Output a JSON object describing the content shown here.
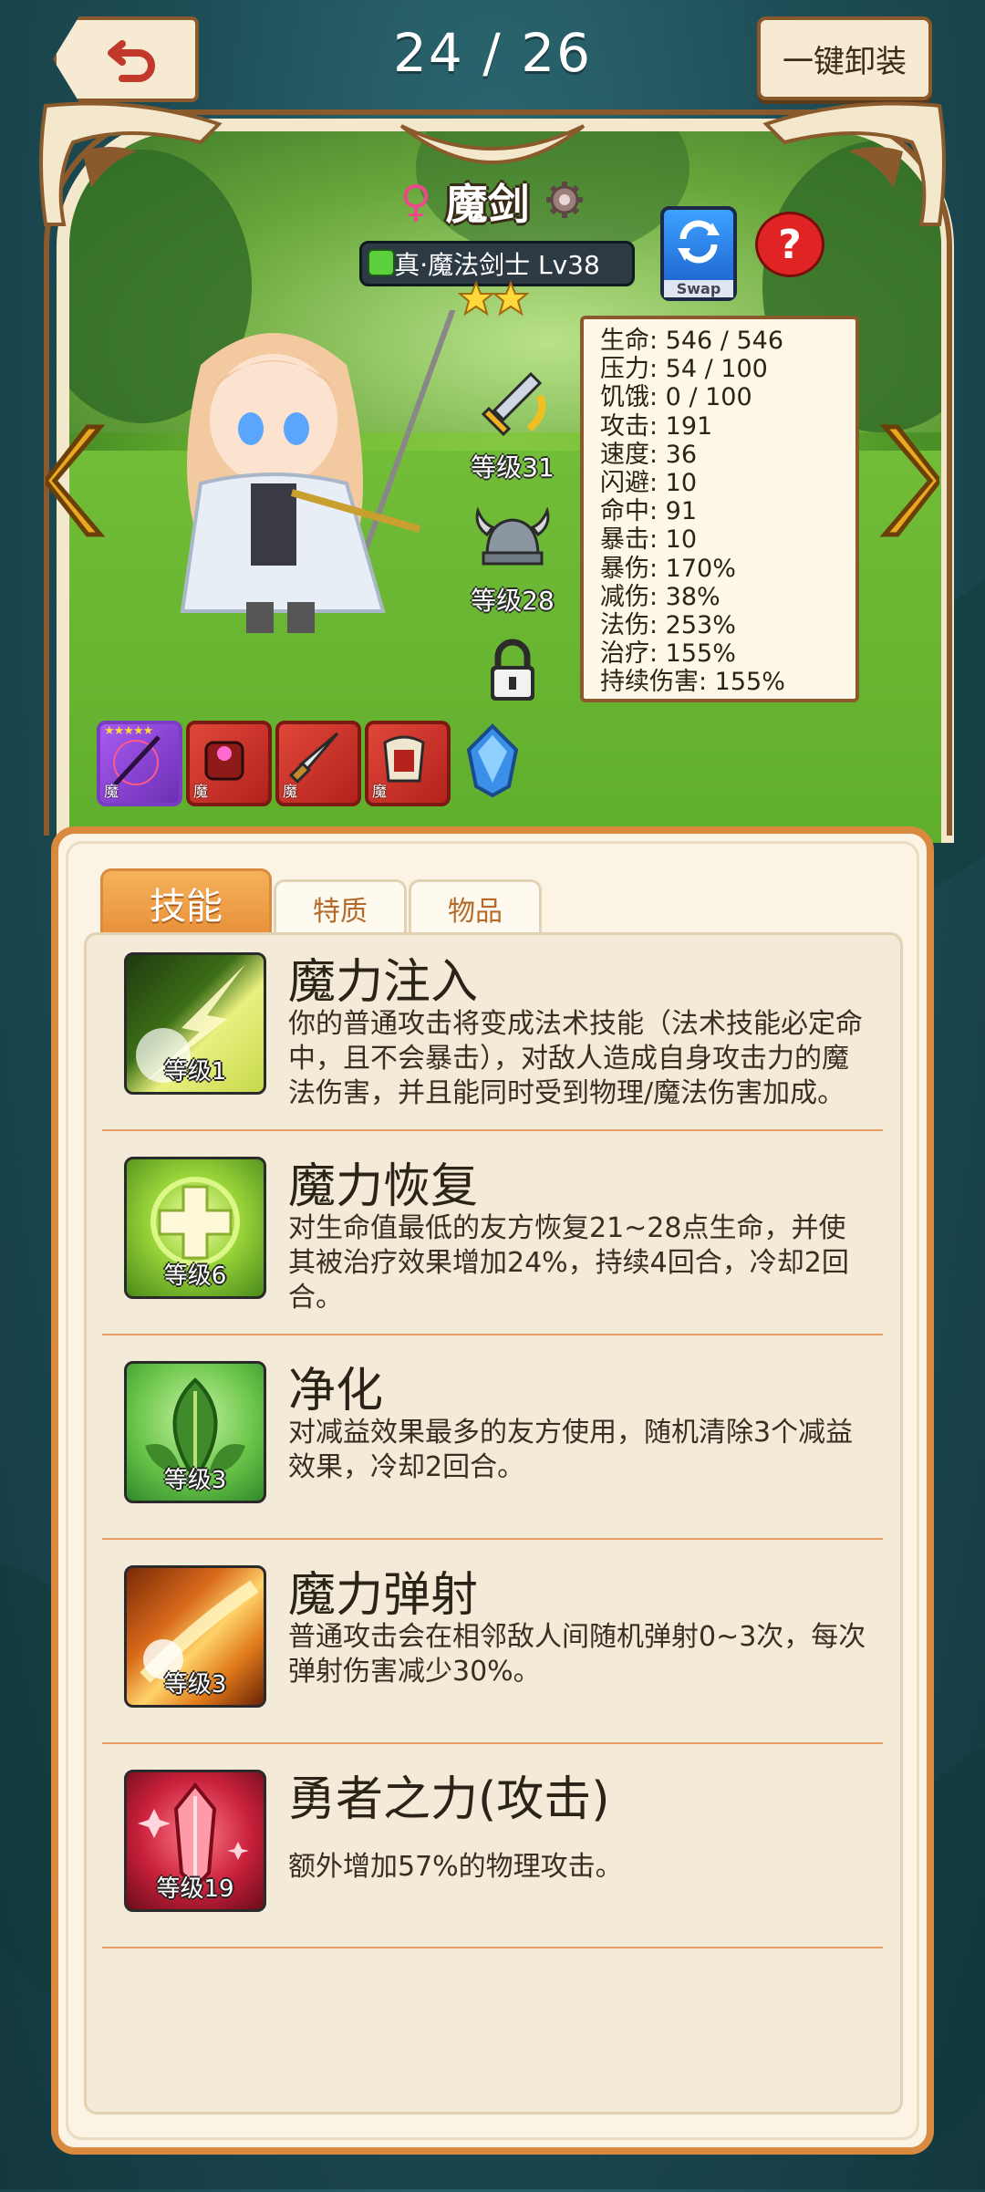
{
  "header": {
    "page_counter": "24 / 26",
    "unequip_all_label": "一键卸装"
  },
  "hero": {
    "gender_symbol": "♀",
    "name": "魔剑",
    "class_level": "真·魔法剑士 Lv38",
    "stars": 2,
    "swap_label": "Swap",
    "help_label": "?"
  },
  "equipment": {
    "weapon_level": "等级31",
    "helmet_level": "等级28"
  },
  "stats": [
    "生命: 546 / 546",
    "压力: 54 / 100",
    "饥饿: 0 / 100",
    "攻击: 191",
    "速度: 36",
    "闪避: 10",
    "命中: 91",
    "暴击: 10",
    "暴伤: 170%",
    "减伤: 38%",
    "法伤: 253%",
    "治疗: 155%",
    "持续伤害: 155%"
  ],
  "items": [
    {
      "tag": "魔",
      "stars": "★★★★★"
    },
    {
      "tag": "魔"
    },
    {
      "tag": "魔"
    },
    {
      "tag": "魔"
    }
  ],
  "tabs": [
    "技能",
    "特质",
    "物品"
  ],
  "skills": [
    {
      "name": "魔力注入",
      "level": "等级1",
      "description": "你的普通攻击将变成法术技能（法术技能必定命中，且不会暴击），对敌人造成自身攻击力的魔法伤害，并且能同时受到物理/魔法伤害加成。"
    },
    {
      "name": "魔力恢复",
      "level": "等级6",
      "description": "对生命值最低的友方恢复21~28点生命，并使其被治疗效果增加24%，持续4回合，冷却2回合。"
    },
    {
      "name": "净化",
      "level": "等级3",
      "description": "对减益效果最多的友方使用，随机清除3个减益效果，冷却2回合。"
    },
    {
      "name": "魔力弹射",
      "level": "等级3",
      "description": "普通攻击会在相邻敌人间随机弹射0~3次，每次弹射伤害减少30%。"
    },
    {
      "name": "勇者之力(攻击)",
      "level": "等级19",
      "description": "额外增加57%的物理攻击。"
    }
  ]
}
